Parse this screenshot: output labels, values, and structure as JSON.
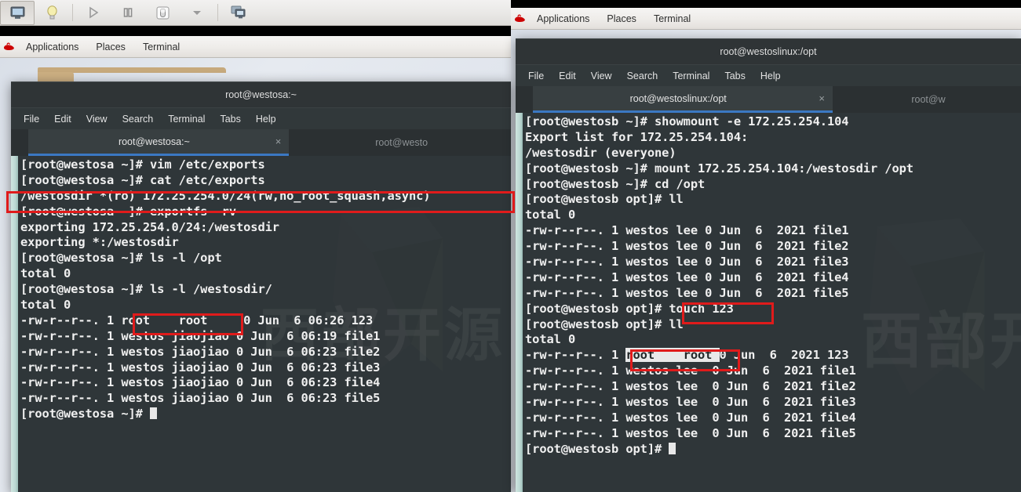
{
  "vm_toolbar": {
    "buttons": [
      {
        "name": "console-view-icon",
        "glyph": "monitor"
      },
      {
        "name": "details-lightbulb-icon",
        "glyph": "bulb"
      },
      {
        "name": "run-icon",
        "glyph": "play"
      },
      {
        "name": "pause-icon",
        "glyph": "pause"
      },
      {
        "name": "shutdown-icon",
        "glyph": "power"
      },
      {
        "name": "shutdown-dropdown-icon",
        "glyph": "caret"
      },
      {
        "name": "snapshots-icon",
        "glyph": "screens"
      }
    ]
  },
  "gnome_left": {
    "logo": "red-hat-logo-icon",
    "items": [
      "Applications",
      "Places",
      "Terminal"
    ]
  },
  "gnome_right": {
    "logo": "red-hat-logo-icon",
    "items": [
      "Applications",
      "Places",
      "Terminal"
    ]
  },
  "left_window": {
    "title": "root@westosa:~",
    "menu": [
      "File",
      "Edit",
      "View",
      "Search",
      "Terminal",
      "Tabs",
      "Help"
    ],
    "tabs": [
      {
        "label": "root@westosa:~",
        "close": "×",
        "active": true
      },
      {
        "label": "root@westo",
        "close": "",
        "active": false
      }
    ],
    "lines": [
      "[root@westosa ~]# vim /etc/exports",
      "[root@westosa ~]# cat /etc/exports",
      "/westosdir *(ro) 172.25.254.0/24(rw,no_root_squash,async)",
      "[root@westosa ~]# exportfs -rv",
      "exporting 172.25.254.0/24:/westosdir",
      "exporting *:/westosdir",
      "[root@westosa ~]# ls -l /opt",
      "total 0",
      "[root@westosa ~]# ls -l /westosdir/",
      "total 0",
      "-rw-r--r--. 1 root    root     0 Jun  6 06:26 123",
      "-rw-r--r--. 1 westos jiaojiao 0 Jun  6 06:19 file1",
      "-rw-r--r--. 1 westos jiaojiao 0 Jun  6 06:23 file2",
      "-rw-r--r--. 1 westos jiaojiao 0 Jun  6 06:23 file3",
      "-rw-r--r--. 1 westos jiaojiao 0 Jun  6 06:23 file4",
      "-rw-r--r--. 1 westos jiaojiao 0 Jun  6 06:23 file5"
    ],
    "prompt": "[root@westosa ~]# "
  },
  "right_window": {
    "title": "root@westoslinux:/opt",
    "menu": [
      "File",
      "Edit",
      "View",
      "Search",
      "Terminal",
      "Tabs",
      "Help"
    ],
    "tabs": [
      {
        "label": "root@westoslinux:/opt",
        "close": "×",
        "active": true
      },
      {
        "label": "root@w",
        "close": "",
        "active": false
      }
    ],
    "lines_before_sel": [
      "[root@westosb ~]# showmount -e 172.25.254.104",
      "Export list for 172.25.254.104:",
      "/westosdir (everyone)",
      "[root@westosb ~]# mount 172.25.254.104:/westosdir /opt",
      "[root@westosb ~]# cd /opt",
      "[root@westosb opt]# ll",
      "total 0",
      "-rw-r--r--. 1 westos lee 0 Jun  6  2021 file1",
      "-rw-r--r--. 1 westos lee 0 Jun  6  2021 file2",
      "-rw-r--r--. 1 westos lee 0 Jun  6  2021 file3",
      "-rw-r--r--. 1 westos lee 0 Jun  6  2021 file4",
      "-rw-r--r--. 1 westos lee 0 Jun  6  2021 file5",
      "[root@westosb opt]# touch 123",
      "[root@westosb opt]# ll",
      "total 0"
    ],
    "sel_line": {
      "prefix": "-rw-r--r--. 1 ",
      "selected": "root    root ",
      "suffix": "0 Jun  6  2021 123"
    },
    "lines_after_sel": [
      "-rw-r--r--. 1 westos lee  0 Jun  6  2021 file1",
      "-rw-r--r--. 1 westos lee  0 Jun  6  2021 file2",
      "-rw-r--r--. 1 westos lee  0 Jun  6  2021 file3",
      "-rw-r--r--. 1 westos lee  0 Jun  6  2021 file4",
      "-rw-r--r--. 1 westos lee  0 Jun  6  2021 file5"
    ],
    "prompt": "[root@westosb opt]# "
  },
  "annotations": {
    "boxes": [
      {
        "name": "exports-line-highlight",
        "color": "#e01b1b"
      },
      {
        "name": "left-root-owner-highlight",
        "color": "#e01b1b"
      },
      {
        "name": "touch-command-highlight",
        "color": "#e01b1b"
      },
      {
        "name": "right-root-owner-highlight",
        "color": "#e01b1b"
      }
    ]
  },
  "watermark": {
    "text": "西部开源"
  },
  "colors": {
    "terminal_bg": "#2f3639",
    "titlebar_bg": "#2f3436",
    "tab_active_bg": "#383f41",
    "tab_underline": "#3b78c3",
    "annotation_red": "#e01b1b",
    "scrollbar": "#bcd8d3"
  }
}
